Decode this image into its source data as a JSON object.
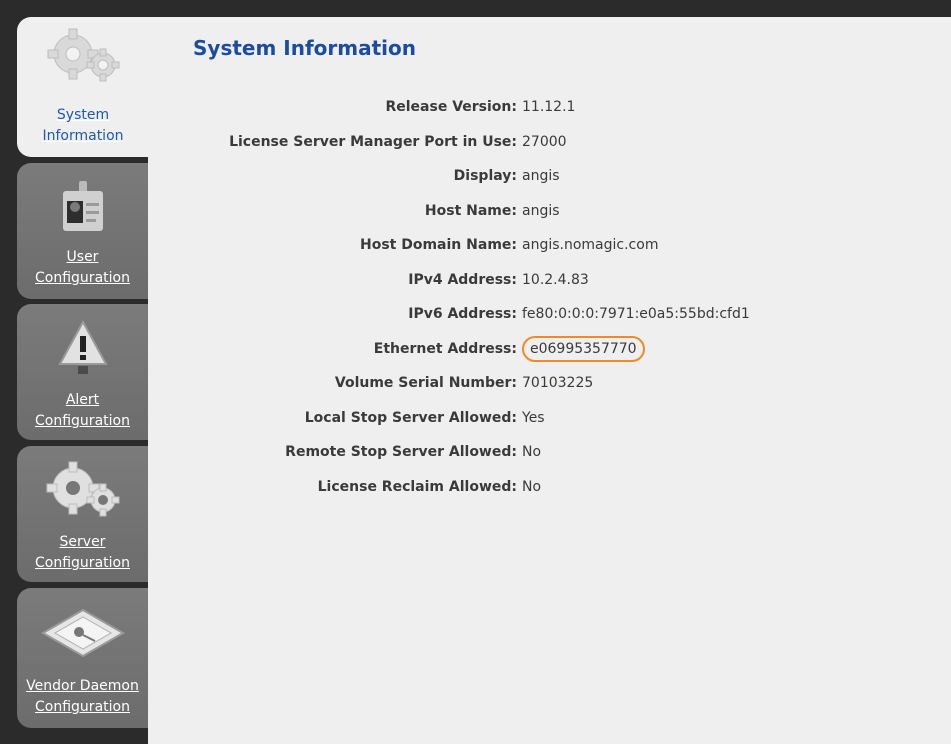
{
  "page": {
    "title": "System Information"
  },
  "nav": {
    "items": [
      {
        "line1": "System",
        "line2": "Information",
        "icon": "gears-icon"
      },
      {
        "line1": "User",
        "line2": "Configuration",
        "icon": "id-badge-icon"
      },
      {
        "line1": "Alert",
        "line2": "Configuration",
        "icon": "warning-icon"
      },
      {
        "line1": "Server",
        "line2": "Configuration",
        "icon": "gears-icon"
      },
      {
        "line1": "Vendor Daemon",
        "line2": "Configuration",
        "icon": "certificate-icon"
      }
    ]
  },
  "info": {
    "rows": [
      {
        "label": "Release Version:",
        "value": "11.12.1"
      },
      {
        "label": "License Server Manager Port in Use:",
        "value": "27000"
      },
      {
        "label": "Display:",
        "value": "angis"
      },
      {
        "label": "Host Name:",
        "value": "angis"
      },
      {
        "label": "Host Domain Name:",
        "value": "angis.nomagic.com"
      },
      {
        "label": "IPv4 Address:",
        "value": "10.2.4.83"
      },
      {
        "label": "IPv6 Address:",
        "value": "fe80:0:0:0:7971:e0a5:55bd:cfd1"
      },
      {
        "label": "Ethernet Address:",
        "value": "e06995357770"
      },
      {
        "label": "Volume Serial Number:",
        "value": "70103225"
      },
      {
        "label": "Local Stop Server Allowed:",
        "value": "Yes"
      },
      {
        "label": "Remote Stop Server Allowed:",
        "value": "No"
      },
      {
        "label": "License Reclaim Allowed:",
        "value": "No"
      }
    ]
  },
  "colors": {
    "highlight": "#f08a24",
    "title": "#1c4d9c"
  }
}
